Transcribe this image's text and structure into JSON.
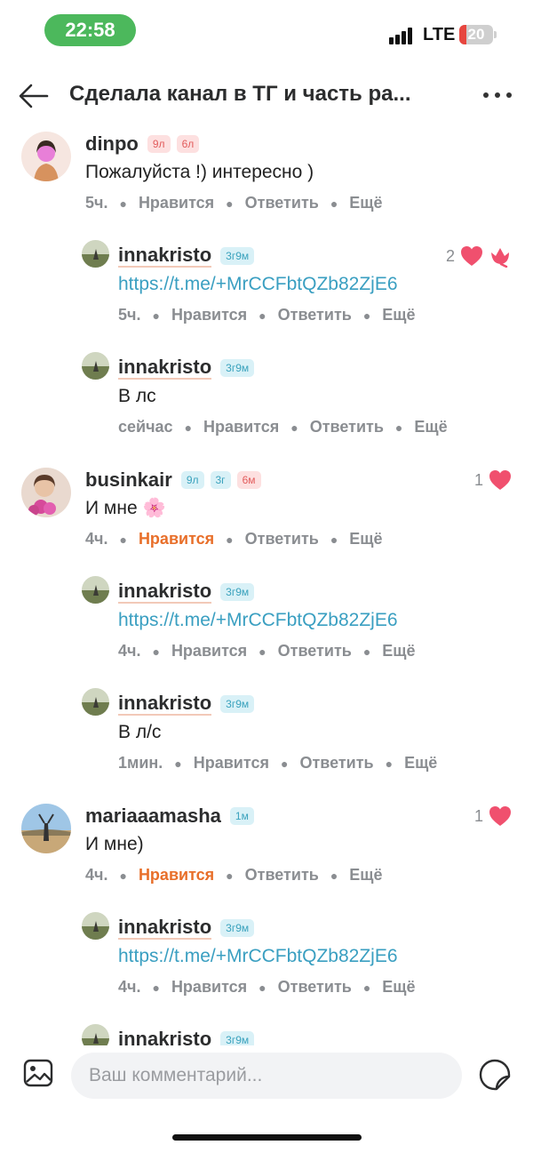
{
  "status_bar": {
    "time": "22:58",
    "network": "LTE",
    "battery": "20"
  },
  "header": {
    "title": "Сделала канал в ТГ и часть ра..."
  },
  "comments": [
    {
      "name": "dinpo",
      "badges": [
        "9л",
        "6л"
      ],
      "text": "Пожалуйста !) интересно )",
      "time": "5ч.",
      "like_label": "Нравится",
      "reply_label": "Ответить",
      "more_label": "Ещё",
      "replies": [
        {
          "name": "innakristo",
          "badge": "3г9м",
          "link": "https://t.me/+MrCCFbtQZb82ZjE6",
          "likes": "2",
          "time": "5ч.",
          "like_label": "Нравится",
          "reply_label": "Ответить",
          "more_label": "Ещё"
        },
        {
          "name": "innakristo",
          "badge": "3г9м",
          "text": "В лс",
          "time": "сейчас",
          "like_label": "Нравится",
          "reply_label": "Ответить",
          "more_label": "Ещё"
        }
      ]
    },
    {
      "name": "businkair",
      "badges": [
        "9л",
        "3г",
        "6м"
      ],
      "text": "И мне 🌸",
      "likes": "1",
      "time": "4ч.",
      "like_label": "Нравится",
      "reply_label": "Ответить",
      "more_label": "Ещё",
      "replies": [
        {
          "name": "innakristo",
          "badge": "3г9м",
          "link": "https://t.me/+MrCCFbtQZb82ZjE6",
          "time": "4ч.",
          "like_label": "Нравится",
          "reply_label": "Ответить",
          "more_label": "Ещё"
        },
        {
          "name": "innakristo",
          "badge": "3г9м",
          "text": "В л/с",
          "time": "1мин.",
          "like_label": "Нравится",
          "reply_label": "Ответить",
          "more_label": "Ещё"
        }
      ]
    },
    {
      "name": "mariaaamasha",
      "badges": [
        "1м"
      ],
      "text": "И мне)",
      "likes": "1",
      "time": "4ч.",
      "like_label": "Нравится",
      "reply_label": "Ответить",
      "more_label": "Ещё",
      "replies": [
        {
          "name": "innakristo",
          "badge": "3г9м",
          "link": "https://t.me/+MrCCFbtQZb82ZjE6",
          "time": "4ч.",
          "like_label": "Нравится",
          "reply_label": "Ответить",
          "more_label": "Ещё"
        },
        {
          "name": "innakristo",
          "badge": "3г9м"
        }
      ]
    }
  ],
  "composer": {
    "placeholder": "Ваш комментарий..."
  },
  "colors": {
    "accent_like": "#e86f2a",
    "link": "#3a9fc1",
    "heart": "#f0506e"
  },
  "icons": [
    "back-arrow-icon",
    "more-dots-icon",
    "heart-icon",
    "tulip-icon",
    "image-icon",
    "sticker-icon"
  ]
}
